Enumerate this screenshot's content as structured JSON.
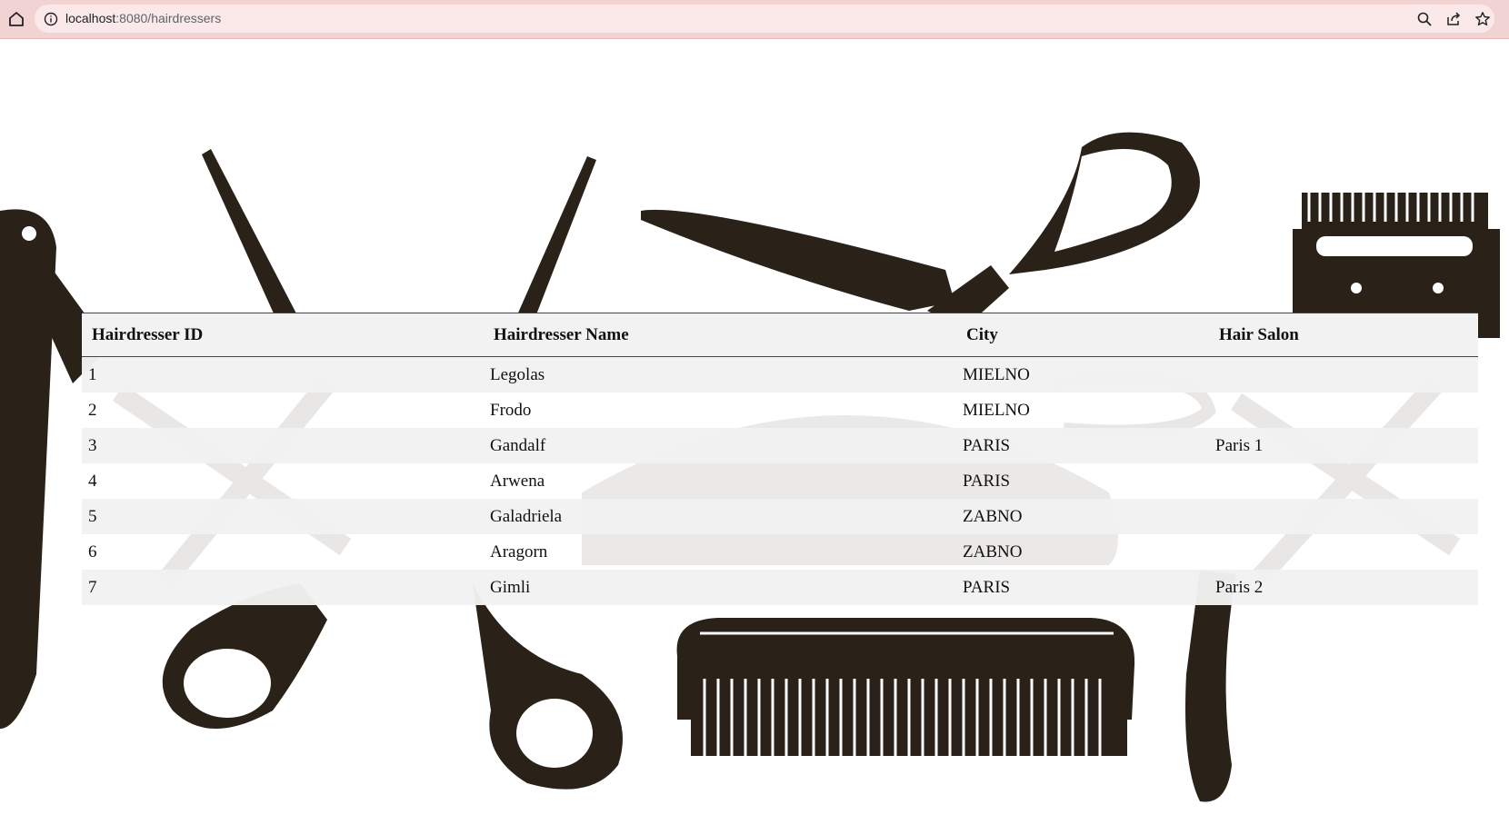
{
  "browser": {
    "url_host": "localhost",
    "url_rest": ":8080/hairdressers",
    "icons": [
      "home-icon",
      "info-icon",
      "zoom-icon",
      "share-icon",
      "star-icon"
    ]
  },
  "table": {
    "headers": [
      "Hairdresser ID",
      "Hairdresser Name",
      "City",
      "Hair Salon"
    ],
    "rows": [
      [
        "1",
        "Legolas",
        "MIELNO",
        ""
      ],
      [
        "2",
        "Frodo",
        "MIELNO",
        ""
      ],
      [
        "3",
        "Gandalf",
        "PARIS",
        "Paris 1"
      ],
      [
        "4",
        "Arwena",
        "PARIS",
        ""
      ],
      [
        "5",
        "Galadriela",
        "ZABNO",
        ""
      ],
      [
        "6",
        "Aragorn",
        "ZABNO",
        ""
      ],
      [
        "7",
        "Gimli",
        "PARIS",
        "Paris 2"
      ]
    ]
  },
  "colors": {
    "chrome": "#f2d3d3",
    "omnibox": "#fbe9e9",
    "art_dark": "#2a2118",
    "art_faint": "#cfcbc8"
  }
}
